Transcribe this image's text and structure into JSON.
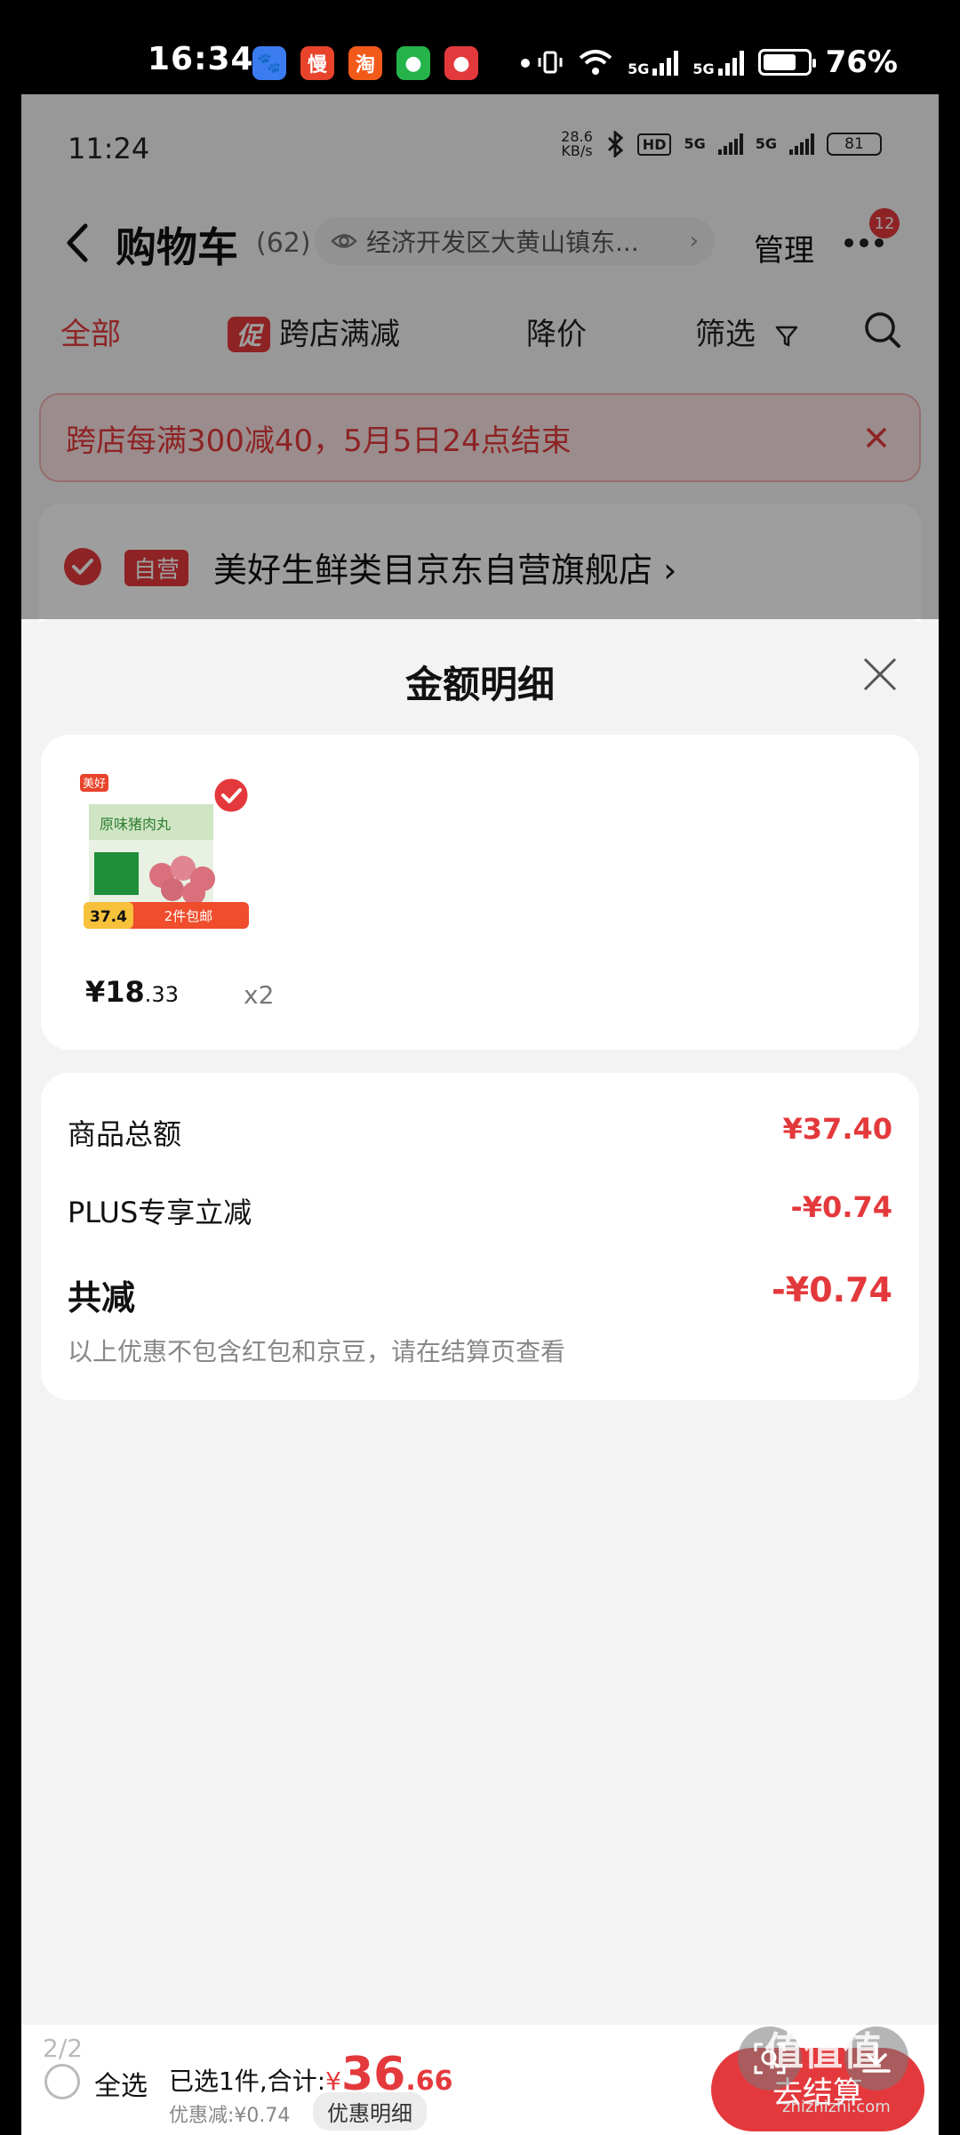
{
  "outer_status": {
    "time": "16:34",
    "battery_pct": "76%",
    "battery_level": 0.76,
    "network_1": "5G",
    "network_2": "5G",
    "apps": [
      {
        "name": "baidu-app-icon",
        "glyph": "🐾",
        "color": "#3b7cf0"
      },
      {
        "name": "man-app-icon",
        "glyph": "慢",
        "color": "#e8442c"
      },
      {
        "name": "taobao-app-icon",
        "glyph": "淘",
        "color": "#f25a1a"
      },
      {
        "name": "message-app-icon",
        "glyph": "●",
        "color": "#26b34a"
      },
      {
        "name": "jd-app-icon",
        "glyph": "●",
        "color": "#e4393c"
      }
    ]
  },
  "inner_status": {
    "time": "11:24",
    "speed": "28.6",
    "speed_unit": "KB/s",
    "hd": "HD",
    "net1": "5G",
    "net2": "5G",
    "battery": "81"
  },
  "cart_header": {
    "title": "购物车",
    "count": "(62)",
    "address": "经济开发区大黄山镇东...",
    "manage": "管理",
    "badge": "12"
  },
  "filter_tabs": {
    "all": "全部",
    "promo_tag": "促",
    "cross_store": "跨店满减",
    "price_drop": "降价",
    "filter": "筛选"
  },
  "promo_banner": {
    "text": "跨店每满300减40，5月5日24点结束"
  },
  "store": {
    "self_tag": "自营",
    "name": "美好生鲜类目京东自营旗舰店 ›"
  },
  "sheet": {
    "title": "金额明细",
    "product": {
      "price_main": "¥18",
      "price_decimal": ".33",
      "qty": "x2",
      "img_brand": "美好",
      "img_name": "原味猪肉丸",
      "img_price": "37.4",
      "img_ship": "2件包邮"
    },
    "summary": {
      "goods_total_label": "商品总额",
      "goods_total_value": "¥37.40",
      "plus_label": "PLUS专享立减",
      "plus_value": "-¥0.74",
      "total_discount_label": "共减",
      "total_discount_value": "-¥0.74",
      "note": "以上优惠不包含红包和京豆，请在结算页查看"
    }
  },
  "bottom_bar": {
    "page_indicator": "2/2",
    "select_all": "全选",
    "selected_prefix": "已选1件,合计:",
    "currency": "¥",
    "total_int": "36",
    "total_dec": ".66",
    "discount": "优惠减:¥0.74",
    "detail_button": "优惠明细",
    "checkout": "去结算"
  },
  "watermark": {
    "text": "值值值",
    "sub": "zhizhizhi.com"
  },
  "colors": {
    "accent": "#e4393c"
  }
}
